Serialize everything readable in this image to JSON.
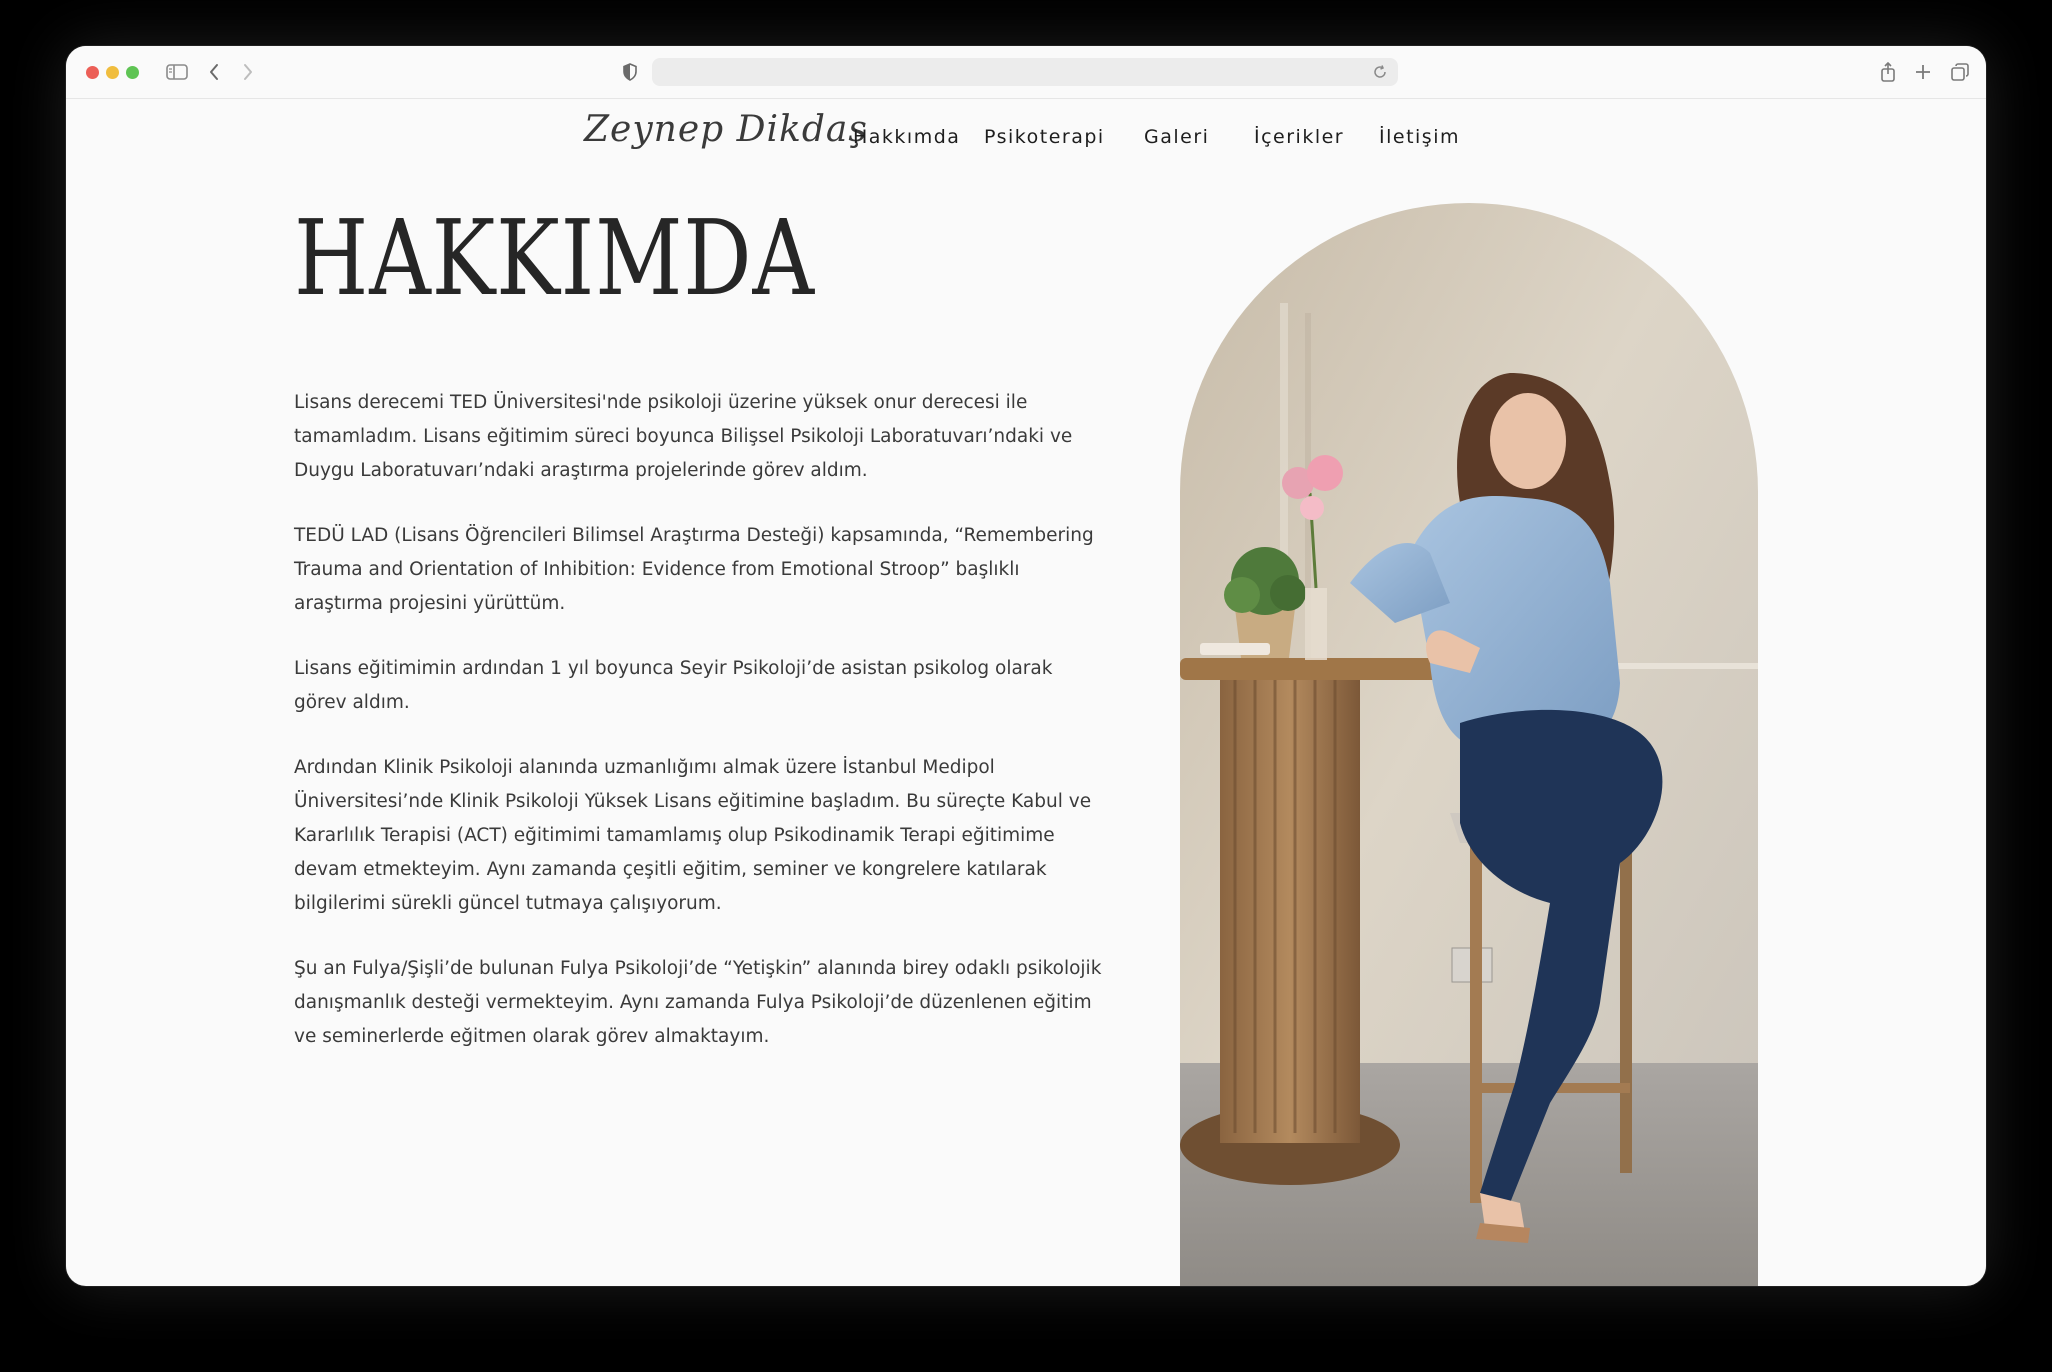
{
  "browser": {
    "address_value": ""
  },
  "site": {
    "logo": "Zeynep Dikdaş",
    "menu": [
      {
        "label": "Hakkımda"
      },
      {
        "label": "Psikoterapi"
      },
      {
        "label": "Galeri"
      },
      {
        "label": "İçerikler"
      },
      {
        "label": "İletişim"
      }
    ]
  },
  "main": {
    "heading": "HAKKIMDA",
    "paragraphs": [
      "Lisans derecemi TED Üniversitesi'nde psikoloji üzerine yüksek onur derecesi ile tamamladım. Lisans eğitimim süreci boyunca Bilişsel Psikoloji Laboratuvarı’ndaki ve Duygu Laboratuvarı’ndaki araştırma projelerinde görev aldım.",
      "TEDÜ LAD (Lisans Öğrencileri Bilimsel Araştırma Desteği) kapsamında, “Remembering Trauma and Orientation of Inhibition: Evidence from Emotional Stroop” başlıklı araştırma projesini yürüttüm.",
      "Lisans eğitimimin ardından 1 yıl boyunca Seyir Psikoloji’de asistan psikolog olarak görev aldım.",
      "Ardından Klinik Psikoloji alanında uzmanlığımı almak üzere İstanbul Medipol Üniversitesi’nde Klinik Psikoloji Yüksek Lisans eğitimine başladım. Bu süreçte Kabul ve Kararlılık Terapisi (ACT) eğitimimi tamamlamış olup Psikodinamik Terapi eğitimime devam etmekteyim. Aynı zamanda çeşitli eğitim, seminer ve kongrelere katılarak bilgilerimi sürekli güncel tutmaya çalışıyorum.",
      "Şu an Fulya/Şişli’de bulunan Fulya Psikoloji’de “Yetişkin” alanında birey odaklı psikolojik danışmanlık desteği vermekteyim. Aynı zamanda Fulya Psikoloji’de düzenlenen eğitim ve seminerlerde eğitmen olarak görev almaktayım."
    ]
  },
  "colors": {
    "page_background": "#fafafa",
    "text": "#3a3a3a",
    "heading": "#262626"
  },
  "icons": [
    "sidebar-icon",
    "back-icon",
    "forward-icon",
    "shield-icon",
    "reload-icon",
    "share-icon",
    "new-tab-icon",
    "tabs-overview-icon"
  ]
}
